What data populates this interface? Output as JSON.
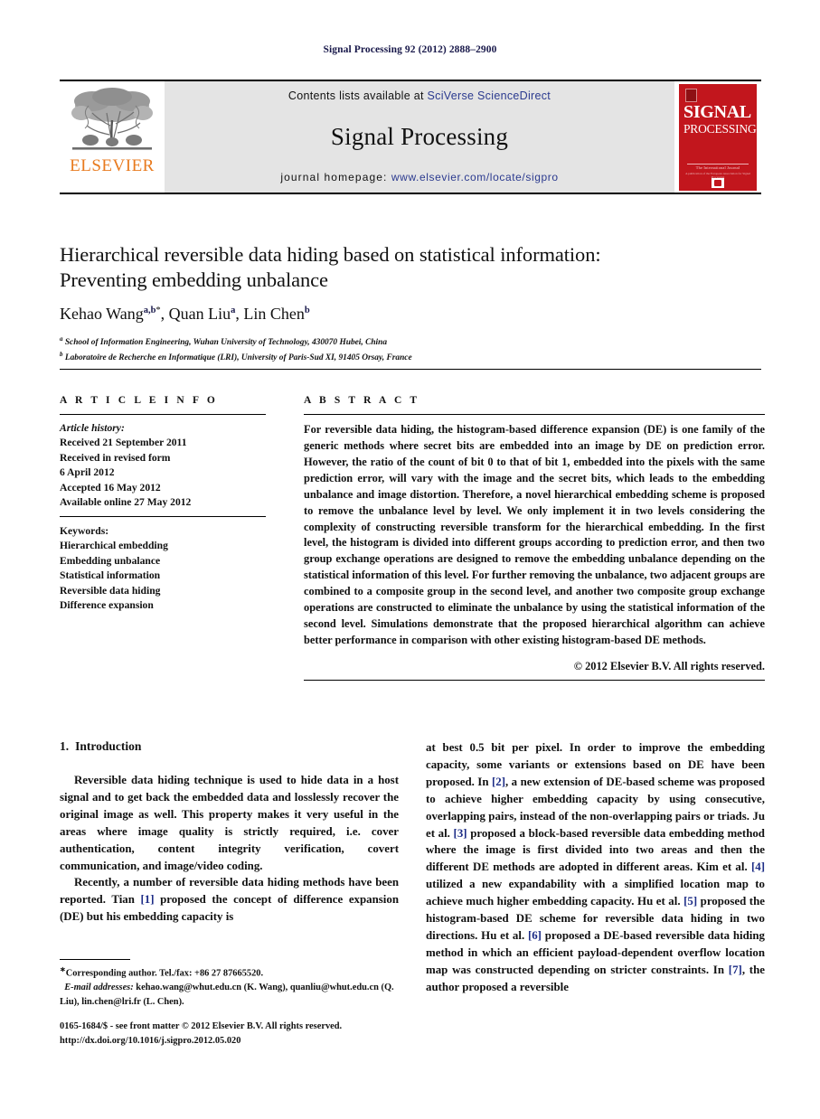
{
  "running_head": "Signal Processing 92 (2012) 2888–2900",
  "masthead": {
    "publisher_name": "ELSEVIER",
    "contents_prefix": "Contents lists available at",
    "contents_link": "SciVerse ScienceDirect",
    "journal_name": "Signal Processing",
    "homepage_prefix": "journal homepage:",
    "homepage_link": "www.elsevier.com/locate/sigpro",
    "cover": {
      "line1": "SIGNAL",
      "line2": "PROCESSING",
      "tagline": "The International Journal",
      "tagline2": "A publication of the European Association for Signal Processing"
    },
    "link_color": "#2b3a8f",
    "elsevier_orange": "#e87a1e",
    "cover_red": "#c2161d"
  },
  "article": {
    "title_line1": "Hierarchical reversible data hiding based on statistical information:",
    "title_line2": "Preventing embedding unbalance",
    "authors": [
      {
        "name": "Kehao Wang",
        "sup": "a,b",
        "star": "*",
        "sep": ", "
      },
      {
        "name": "Quan Liu",
        "sup": "a",
        "star": "",
        "sep": ", "
      },
      {
        "name": "Lin Chen",
        "sup": "b",
        "star": "",
        "sep": ""
      }
    ],
    "affiliations": [
      {
        "label": "a",
        "text": "School of Information Engineering, Wuhan University of Technology, 430070 Hubei, China"
      },
      {
        "label": "b",
        "text": "Laboratoire de Recherche en Informatique (LRI), University of Paris-Sud XI, 91405 Orsay, France"
      }
    ]
  },
  "article_info": {
    "heading": "A R T I C L E  I N F O",
    "history_label": "Article history:",
    "history": [
      "Received 21 September 2011",
      "Received in revised form",
      "6 April 2012",
      "Accepted 16 May 2012",
      "Available online 27 May 2012"
    ],
    "keywords_label": "Keywords:",
    "keywords": [
      "Hierarchical embedding",
      "Embedding unbalance",
      "Statistical information",
      "Reversible data hiding",
      "Difference expansion"
    ]
  },
  "abstract": {
    "heading": "A B S T R A C T",
    "text": "For reversible data hiding, the histogram-based difference expansion (DE) is one family of the generic methods where secret bits are embedded into an image by DE on prediction error. However, the ratio of the count of bit 0 to that of bit 1, embedded into the pixels with the same prediction error, will vary with the image and the secret bits, which leads to the embedding unbalance and image distortion. Therefore, a novel hierarchical embedding scheme is proposed to remove the unbalance level by level. We only implement it in two levels considering the complexity of constructing reversible transform for the hierarchical embedding. In the first level, the histogram is divided into different groups according to prediction error, and then two group exchange operations are designed to remove the embedding unbalance depending on the statistical information of this level. For further removing the unbalance, two adjacent groups are combined to a composite group in the second level, and another two composite group exchange operations are constructed to eliminate the unbalance by using the statistical information of the second level. Simulations demonstrate that the proposed hierarchical algorithm can achieve better performance in comparison with other existing histogram-based DE methods.",
    "copyright": "© 2012 Elsevier B.V. All rights reserved."
  },
  "introduction": {
    "number": "1.",
    "heading": "Introduction",
    "left_paragraphs": [
      "Reversible data hiding technique is used to hide data in a host signal and to get back the embedded data and losslessly recover the original image as well. This property makes it very useful in the areas where image quality is strictly required, i.e. cover authentication, content integrity verification, covert communication, and image/video coding."
    ],
    "p2_part1": "Recently, a number of reversible data hiding methods have been reported. Tian ",
    "p2_ref1": "[1]",
    "p2_part2": " proposed the concept of difference expansion (DE) but his embedding capacity is",
    "right_part1": "at best 0.5 bit per pixel. In order to improve the embedding capacity, some variants or extensions based on DE have been proposed. In ",
    "right_ref2": "[2]",
    "right_part2": ", a new extension of DE-based scheme was proposed to achieve higher embedding capacity by using consecutive, overlapping pairs, instead of the non-overlapping pairs or triads. Ju et al. ",
    "right_ref3": "[3]",
    "right_part3": " proposed a block-based reversible data embedding method where the image is first divided into two areas and then the different DE methods are adopted in different areas. Kim et al. ",
    "right_ref4": "[4]",
    "right_part4": " utilized a new expandability with a simplified location map to achieve much higher embedding capacity. Hu et al. ",
    "right_ref5": "[5]",
    "right_part5": " proposed the histogram-based DE scheme for reversible data hiding in two directions. Hu et al. ",
    "right_ref6": "[6]",
    "right_part6": " proposed a DE-based reversible data hiding method in which an efficient payload-dependent overflow location map was constructed depending on stricter constraints. In ",
    "right_ref7": "[7]",
    "right_part7": ", the author proposed a reversible"
  },
  "footnotes": {
    "corresponding": "Corresponding author. Tel./fax: +86 27 87665520.",
    "email_label": "E-mail addresses:",
    "emails": "kehao.wang@whut.edu.cn (K. Wang), quanliu@whut.edu.cn (Q. Liu), lin.chen@lri.fr (L. Chen).",
    "issn_line": "0165-1684/$ - see front matter © 2012 Elsevier B.V. All rights reserved.",
    "doi_line": "http://dx.doi.org/10.1016/j.sigpro.2012.05.020"
  }
}
